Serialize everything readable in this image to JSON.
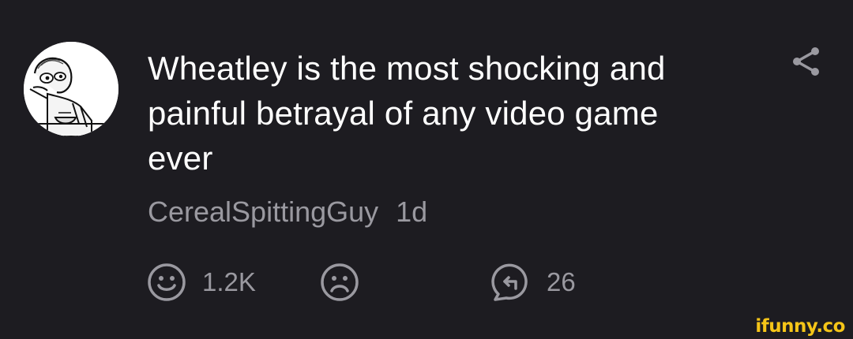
{
  "comment": {
    "text": "Wheatley is the most shocking and painful betrayal of any video game ever",
    "username": "CerealSpittingGuy",
    "time": "1d"
  },
  "actions": {
    "likes": "1.2K",
    "replies": "26"
  },
  "icons": {
    "avatar": "cereal-guy-meme-avatar",
    "share": "share-icon",
    "like": "smile-face-icon",
    "dislike": "sad-face-icon",
    "reply": "reply-bubble-icon"
  },
  "colors": {
    "background": "#1d1c21",
    "text": "#ffffff",
    "muted": "#9a99a0",
    "watermark": "#f5c518"
  },
  "watermark": "ifunny.co"
}
